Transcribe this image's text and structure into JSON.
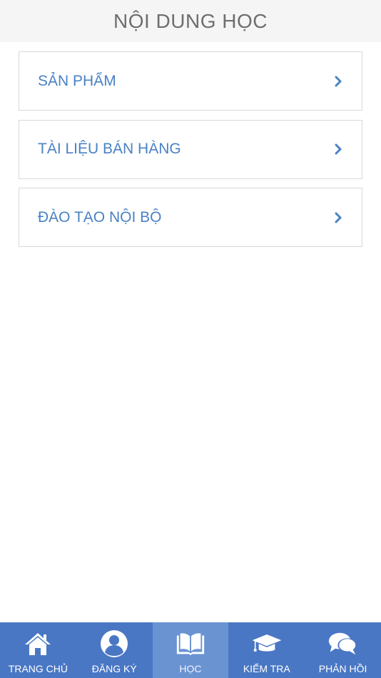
{
  "header": {
    "title": "NỘI DUNG HỌC"
  },
  "menu": {
    "items": [
      {
        "label": "SẢN PHẨM"
      },
      {
        "label": "TÀI LIỆU BÁN HÀNG"
      },
      {
        "label": "ĐÀO TẠO NỘI BỘ"
      }
    ]
  },
  "tabbar": {
    "active": "HỌC",
    "items": [
      {
        "label": "TRANG CHỦ",
        "icon": "home-icon"
      },
      {
        "label": "ĐĂNG KÝ",
        "icon": "user-icon"
      },
      {
        "label": "HỌC",
        "icon": "book-icon"
      },
      {
        "label": "KIỂM TRA",
        "icon": "graduation-cap-icon"
      },
      {
        "label": "PHẢN HỒI",
        "icon": "chat-bubbles-icon"
      }
    ]
  },
  "colors": {
    "accent": "#4a81c4",
    "tabbar": "#4a77c4",
    "tabbar_active": "#6a93d2",
    "header_bg": "#f5f5f5",
    "header_text": "#6e6e6e"
  }
}
